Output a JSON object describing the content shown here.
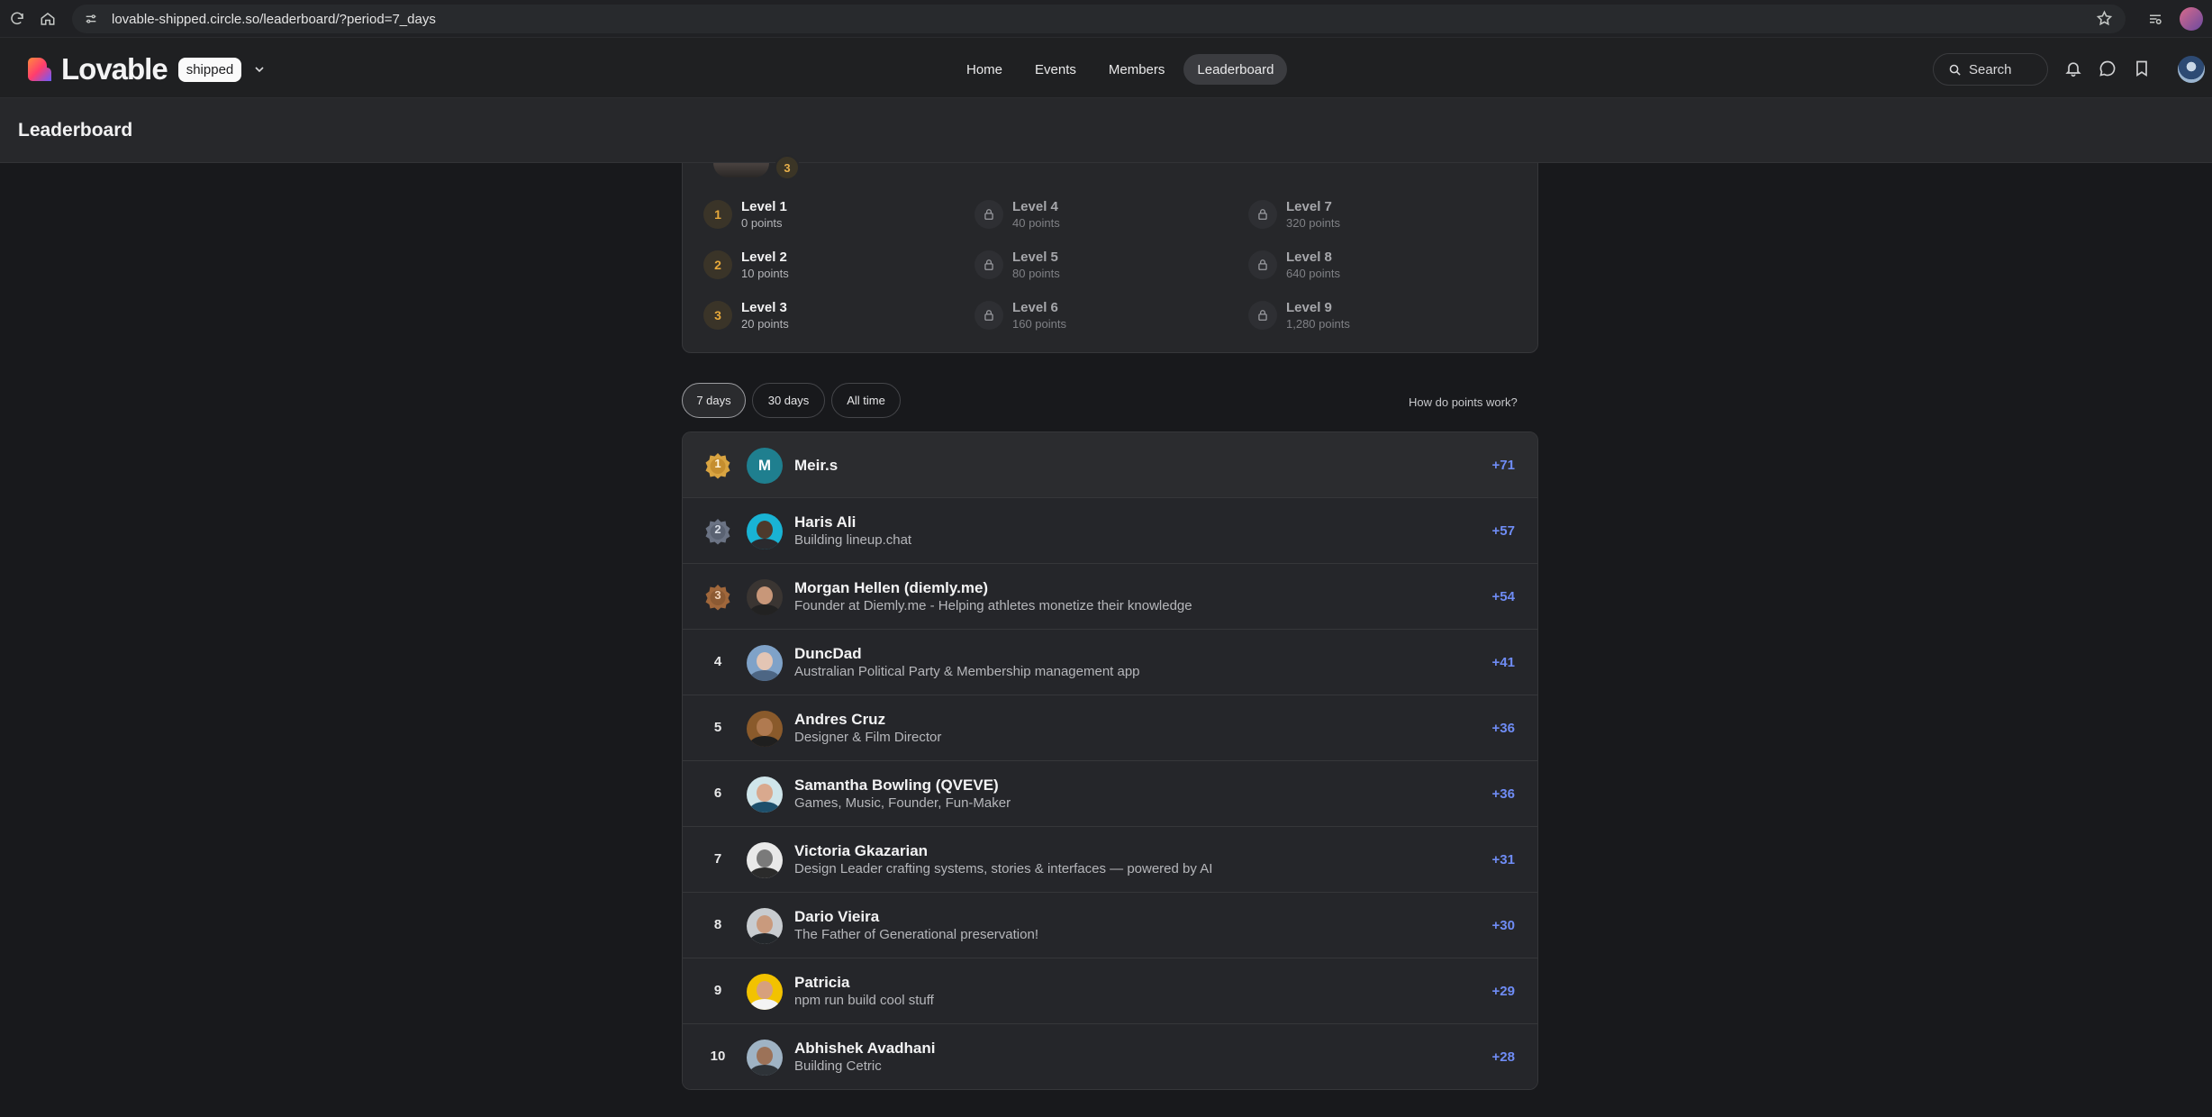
{
  "browser": {
    "url": "lovable-shipped.circle.so/leaderboard/?period=7_days"
  },
  "header": {
    "brand": "Lovable",
    "badge": "shipped",
    "nav": [
      {
        "label": "Home"
      },
      {
        "label": "Events"
      },
      {
        "label": "Members"
      },
      {
        "label": "Leaderboard",
        "active": true
      }
    ],
    "search_label": "Search"
  },
  "page": {
    "title": "Leaderboard"
  },
  "levels": {
    "current_level": "3",
    "items": [
      {
        "badge": "1",
        "name": "Level 1",
        "points": "0 points",
        "locked": false
      },
      {
        "badge": "2",
        "name": "Level 2",
        "points": "10 points",
        "locked": false
      },
      {
        "badge": "3",
        "name": "Level 3",
        "points": "20 points",
        "locked": false
      },
      {
        "name": "Level 4",
        "points": "40 points",
        "locked": true
      },
      {
        "name": "Level 5",
        "points": "80 points",
        "locked": true
      },
      {
        "name": "Level 6",
        "points": "160 points",
        "locked": true
      },
      {
        "name": "Level 7",
        "points": "320 points",
        "locked": true
      },
      {
        "name": "Level 8",
        "points": "640 points",
        "locked": true
      },
      {
        "name": "Level 9",
        "points": "1,280 points",
        "locked": true
      }
    ]
  },
  "filters": {
    "options": [
      {
        "label": "7 days",
        "active": true
      },
      {
        "label": "30 days",
        "active": false
      },
      {
        "label": "All time",
        "active": false
      }
    ],
    "help_link": "How do points work?"
  },
  "leaderboard": {
    "rows": [
      {
        "rank": "1",
        "initial": "M",
        "name": "Meir.s",
        "bio": "",
        "score": "+71"
      },
      {
        "rank": "2",
        "name": "Haris Ali",
        "bio": "Building lineup.chat",
        "score": "+57"
      },
      {
        "rank": "3",
        "name": "Morgan Hellen (diemly.me)",
        "bio": "Founder at Diemly.me - Helping athletes monetize their knowledge",
        "score": "+54"
      },
      {
        "rank": "4",
        "name": "DuncDad",
        "bio": "Australian Political Party & Membership management app",
        "score": "+41"
      },
      {
        "rank": "5",
        "name": "Andres Cruz",
        "bio": "Designer & Film Director",
        "score": "+36"
      },
      {
        "rank": "6",
        "name": "Samantha Bowling (QVEVE)",
        "bio": "Games, Music, Founder, Fun-Maker",
        "score": "+36"
      },
      {
        "rank": "7",
        "name": "Victoria Gkazarian",
        "bio": "Design Leader crafting systems, stories & interfaces — powered by AI",
        "score": "+31"
      },
      {
        "rank": "8",
        "name": "Dario Vieira",
        "bio": "The Father of Generational preservation!",
        "score": "+30"
      },
      {
        "rank": "9",
        "name": "Patricia",
        "bio": "npm run build cool stuff",
        "score": "+29"
      },
      {
        "rank": "10",
        "name": "Abhishek Avadhani",
        "bio": "Building Cetric",
        "score": "+28"
      }
    ]
  },
  "colors": {
    "accent_score": "#6f8cf5",
    "gold": "#d9a441",
    "silver": "#6b7384",
    "bronze": "#a0673b",
    "level_badge": "#e7a93b"
  }
}
